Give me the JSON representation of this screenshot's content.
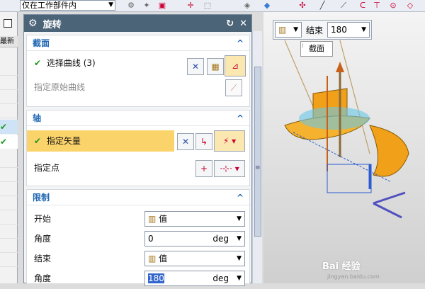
{
  "toolbar": {
    "filter_select": "仅在工作部件内",
    "icons": [
      "filter-icon",
      "snap-icon",
      "point-icon",
      "select-box-icon",
      "cube-icon",
      "grid-icon",
      "line-icon",
      "arc-icon",
      "circle-icon",
      "snap-center-icon"
    ]
  },
  "left_strip": {
    "header": "最新"
  },
  "dialog": {
    "title": "旋转",
    "section_profile": {
      "title": "截面",
      "select_curve": "选择曲线 (3)",
      "specify_origin": "指定原始曲线"
    },
    "section_axis": {
      "title": "轴",
      "specify_vector": "指定矢量",
      "specify_point": "指定点"
    },
    "section_limits": {
      "title": "限制",
      "start_label": "开始",
      "start_value": "值",
      "angle1_label": "角度",
      "angle1_value": "0",
      "angle1_unit": "deg",
      "end_label": "结束",
      "end_value": "值",
      "angle2_label": "角度",
      "angle2_value": "180",
      "angle2_unit": "deg"
    }
  },
  "viewport": {
    "end_label": "结束",
    "end_value": "180",
    "tooltip": "截面"
  },
  "watermark": {
    "brand": "Bai 经验",
    "url": "jingyan.baidu.com"
  },
  "colors": {
    "title_bar": "#4c6478",
    "section_header": "#2168b4",
    "highlight": "#fbd36b",
    "check": "#1a9a1a",
    "selection": "#3366cc"
  }
}
